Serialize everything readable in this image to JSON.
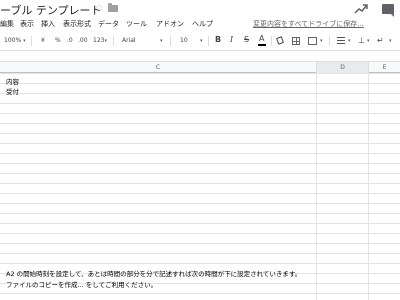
{
  "title": {
    "doc_title": "ーブル テンプレート",
    "star_icon": "star-icon",
    "folder_icon": "folder-icon",
    "trend_icon": "trending-up-icon",
    "comment_icon": "comment-icon"
  },
  "menu": {
    "items": [
      "編集",
      "表示",
      "挿入",
      "表示形式",
      "データ",
      "ツール",
      "アドオン",
      "ヘルプ"
    ],
    "save_status": "変更内容をすべてドライブに保存..."
  },
  "toolbar": {
    "zoom": "100%",
    "currency": "¥",
    "percent": "%",
    "decrease_decimal": ".0",
    "increase_decimal": ".00",
    "more_formats": "123",
    "font": "Arial",
    "font_size": "10",
    "bold": "B",
    "italic": "I",
    "strikethrough": "S",
    "text_color": "A"
  },
  "grid": {
    "columns": [
      {
        "label": "C",
        "selected": false
      },
      {
        "label": "D",
        "selected": true
      },
      {
        "label": "E",
        "selected": false
      }
    ],
    "cells": {
      "r1": "内容",
      "r2": "受付",
      "note1": "A2 の開始時刻を設定して、あとは時間の部分を分で記述すれば次の時間が下に設定されていきます。",
      "note2": "ファイルのコピーを作成... をしてご利用ください。"
    }
  },
  "colors": {
    "gridline": "#e2e3e3",
    "header_bg": "#f8f9fa",
    "selected_header_bg": "#e8eaed"
  }
}
